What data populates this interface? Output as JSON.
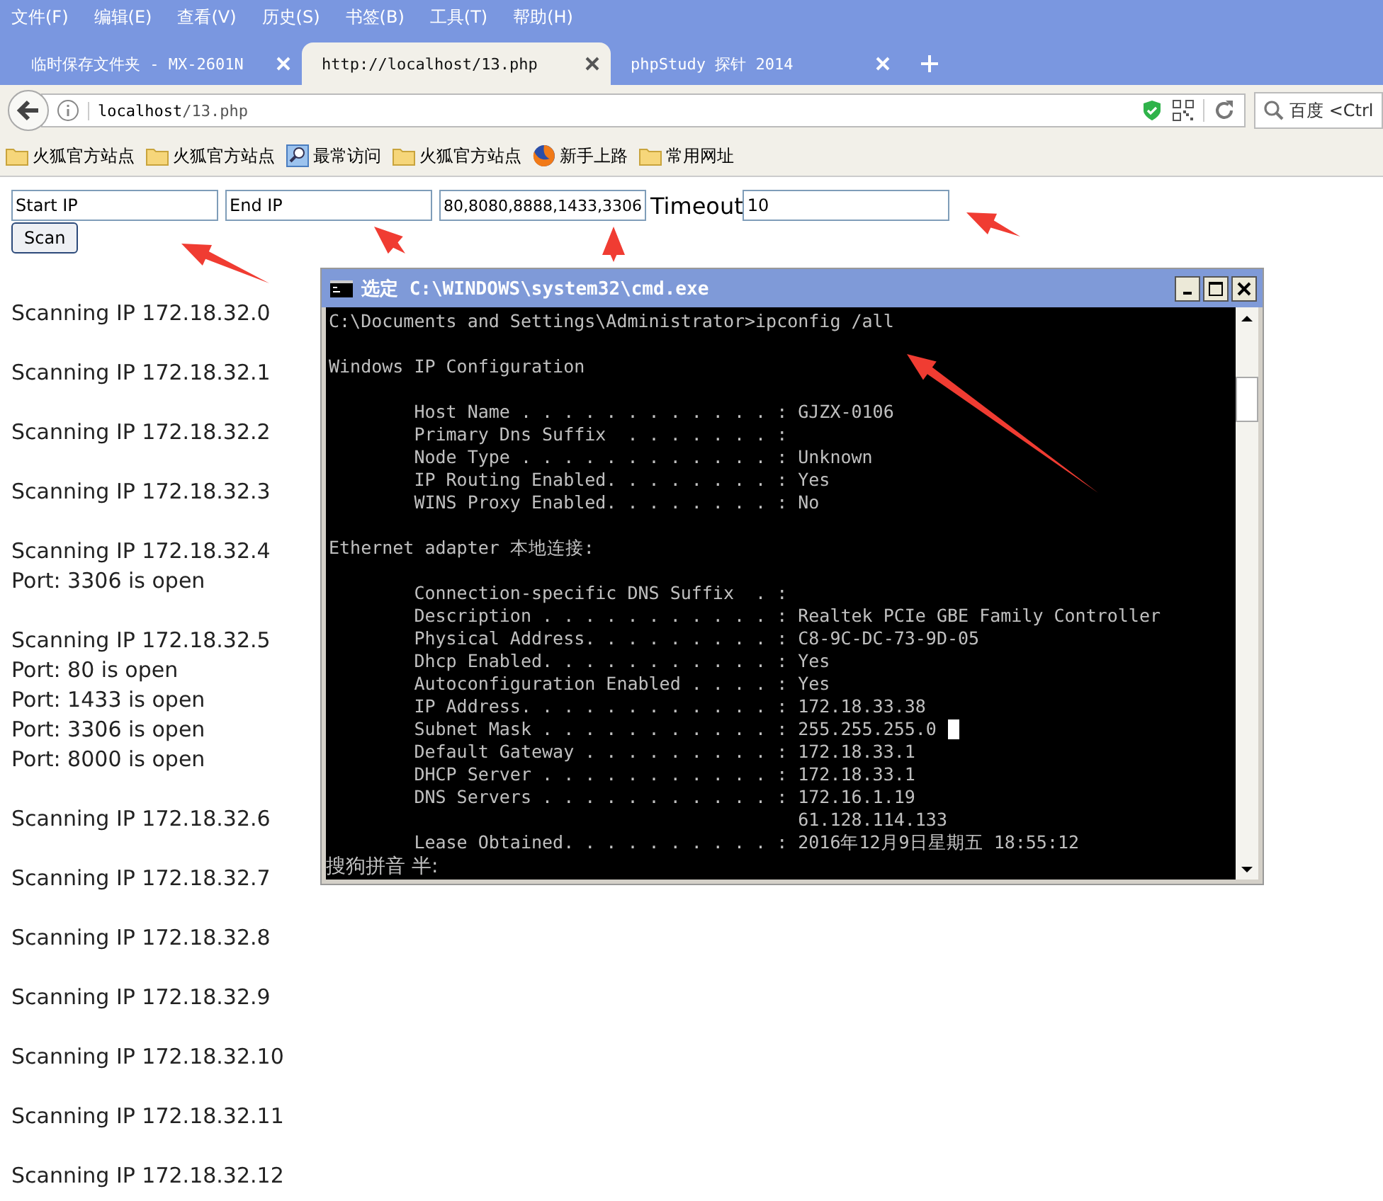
{
  "menu": [
    "文件(F)",
    "编辑(E)",
    "查看(V)",
    "历史(S)",
    "书签(B)",
    "工具(T)",
    "帮助(H)"
  ],
  "tabs": [
    {
      "label": "临时保存文件夹 - MX-2601N",
      "selected": false
    },
    {
      "label": "http://localhost/13.php",
      "selected": true
    },
    {
      "label": "phpStudy 探针 2014",
      "selected": false
    }
  ],
  "address": {
    "host": "localhost",
    "path": "/13.php"
  },
  "search": {
    "placeholder": "百度 <Ctrl"
  },
  "bookmarks": [
    {
      "label": "火狐官方站点",
      "kind": "folder"
    },
    {
      "label": "火狐官方站点",
      "kind": "folder"
    },
    {
      "label": "最常访问",
      "kind": "special"
    },
    {
      "label": "火狐官方站点",
      "kind": "folder"
    },
    {
      "label": "新手上路",
      "kind": "browser"
    },
    {
      "label": "常用网址",
      "kind": "folder"
    }
  ],
  "form": {
    "start_ip": "Start IP",
    "end_ip": "End IP",
    "ports": "80,8080,8888,1433,3306",
    "timeout_label": "Timeout",
    "timeout": "10",
    "scan_button": "Scan"
  },
  "results": [
    {
      "line": "Scanning IP 172.18.32.0"
    },
    {
      "line": "Scanning IP 172.18.32.1"
    },
    {
      "line": "Scanning IP 172.18.32.2"
    },
    {
      "line": "Scanning IP 172.18.32.3"
    },
    {
      "line": "Scanning IP 172.18.32.4",
      "ports": [
        "Port: 3306 is open"
      ]
    },
    {
      "line": "Scanning IP 172.18.32.5",
      "ports": [
        "Port: 80 is open",
        "Port: 1433 is open",
        "Port: 3306 is open",
        "Port: 8000 is open"
      ]
    },
    {
      "line": "Scanning IP 172.18.32.6"
    },
    {
      "line": "Scanning IP 172.18.32.7"
    },
    {
      "line": "Scanning IP 172.18.32.8"
    },
    {
      "line": "Scanning IP 172.18.32.9"
    },
    {
      "line": "Scanning IP 172.18.32.10"
    },
    {
      "line": "Scanning IP 172.18.32.11"
    },
    {
      "line": "Scanning IP 172.18.32.12"
    }
  ],
  "console": {
    "title": "选定 C:\\WINDOWS\\system32\\cmd.exe",
    "blocks": [
      {
        "lines": [
          {
            "text": "C:\\Documents and Settings\\Administrator>ipconfig /all"
          }
        ]
      },
      {
        "lines": [
          {
            "text": "Windows IP Configuration"
          }
        ]
      },
      {
        "lines": [
          {
            "text": "        Host Name . . . . . . . . . . . . : GJZX-0106"
          },
          {
            "text": "        Primary Dns Suffix  . . . . . . . :"
          },
          {
            "text": "        Node Type . . . . . . . . . . . . : Unknown"
          },
          {
            "text": "        IP Routing Enabled. . . . . . . . : Yes"
          },
          {
            "text": "        WINS Proxy Enabled. . . . . . . . : No"
          }
        ]
      },
      {
        "lines": [
          {
            "text": "Ethernet adapter 本地连接:"
          }
        ]
      },
      {
        "lines": [
          {
            "text": "        Connection-specific DNS Suffix  . :"
          },
          {
            "text": "        Description . . . . . . . . . . . : Realtek PCIe GBE Family Controller"
          },
          {
            "text": "        Physical Address. . . . . . . . . : C8-9C-DC-73-9D-05"
          },
          {
            "text": "        Dhcp Enabled. . . . . . . . . . . : Yes"
          },
          {
            "text": "        Autoconfiguration Enabled . . . . : Yes"
          },
          {
            "text": "        IP Address. . . . . . . . . . . . : 172.18.33.38"
          },
          {
            "text": "        Subnet Mask . . . . . . . . . . . : 255.255.255.0",
            "cursor": true
          },
          {
            "text": "        Default Gateway . . . . . . . . . : 172.18.33.1"
          },
          {
            "text": "        DHCP Server . . . . . . . . . . . : 172.18.33.1"
          },
          {
            "text": "        DNS Servers . . . . . . . . . . . : 172.16.1.19"
          },
          {
            "text": "                                            61.128.114.133"
          },
          {
            "text": "        Lease Obtained. . . . . . . . . . : 2016年12月9日星期五 18:55:12"
          }
        ]
      }
    ],
    "ime_status": "搜狗拼音 半:"
  }
}
